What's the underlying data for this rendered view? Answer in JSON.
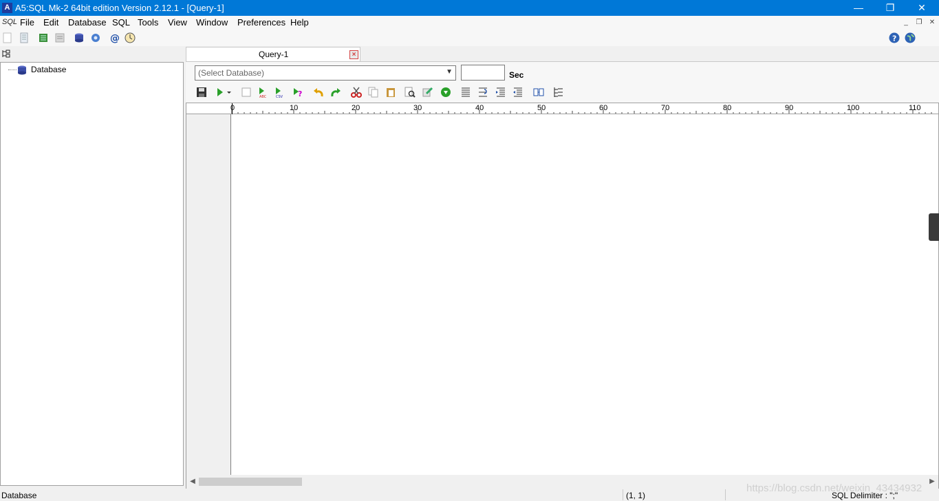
{
  "window": {
    "title": "A5:SQL Mk-2 64bit edition Version 2.12.1 - [Query-1]",
    "app_icon_text": "A",
    "minimize": "—",
    "restore": "❐",
    "close": "✕"
  },
  "menubar": {
    "logo": "SQL",
    "items": [
      "File",
      "Edit",
      "Database",
      "SQL",
      "Tools",
      "View",
      "Window",
      "Preferences",
      "Help"
    ],
    "mdi_minimize": "_",
    "mdi_restore": "❐",
    "mdi_close": "✕"
  },
  "main_toolbar": {
    "icons": [
      "new-file-icon",
      "open-file-icon",
      "connect-db-icon",
      "disconnect-db-icon",
      "database-icon",
      "settings-icon",
      "at-icon",
      "clock-icon",
      "help-icon",
      "globe-icon"
    ]
  },
  "sidebar": {
    "tree_root_label": "Database"
  },
  "tabs": [
    {
      "label": "Query-1",
      "close": "×"
    }
  ],
  "query": {
    "database_select_placeholder": "(Select Database)",
    "timeout_value": "",
    "timeout_unit": "Sec",
    "toolbar_icons": [
      "save-icon",
      "execute-icon",
      "stop-icon",
      "export-abc-icon",
      "export-csv-icon",
      "explain-icon",
      "undo-icon",
      "redo-icon",
      "cut-icon",
      "copy-icon",
      "paste-icon",
      "find-icon",
      "replace-icon",
      "refresh-icon",
      "align-icon",
      "wrap-icon",
      "indent-icon",
      "outdent-icon",
      "layout-icon",
      "tree-icon"
    ]
  },
  "editor": {
    "ruler_labels": [
      "0",
      "10",
      "20",
      "30",
      "40",
      "50",
      "60",
      "70",
      "80",
      "90",
      "100",
      "110"
    ],
    "content": ""
  },
  "statusbar": {
    "left": "Database",
    "position": "(1, 1)",
    "delimiter": "SQL Delimiter : \";\""
  },
  "watermark": "https://blog.csdn.net/weixin_43434932",
  "colors": {
    "titlebar": "#0078d7",
    "background": "#f0f0f0"
  }
}
